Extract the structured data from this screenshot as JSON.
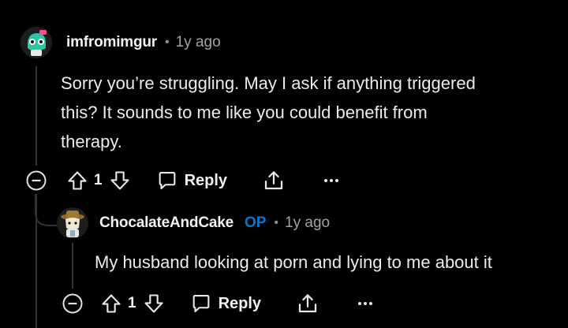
{
  "comments": [
    {
      "username": "imfromimgur",
      "op_badge": "",
      "time": "1y ago",
      "body_lines": [
        "Sorry you’re struggling. May I ask if anything triggered",
        "this? It sounds to me like you could benefit from",
        "therapy."
      ],
      "votes": "1",
      "reply_label": "Reply"
    },
    {
      "username": "ChocalateAndCake",
      "op_badge": "OP",
      "time": "1y ago",
      "body_lines": [
        "My husband looking at porn and lying to me about it"
      ],
      "votes": "1",
      "reply_label": "Reply"
    }
  ],
  "separator": "•",
  "icons": [
    "collapse-icon",
    "upvote-icon",
    "downvote-icon",
    "reply-icon",
    "share-icon",
    "more-icon"
  ],
  "colors": {
    "background": "#000000",
    "text": "#ececec",
    "op_badge": "#0079d3",
    "muted": "#a0a4a8",
    "thread_line": "#2f3336"
  }
}
